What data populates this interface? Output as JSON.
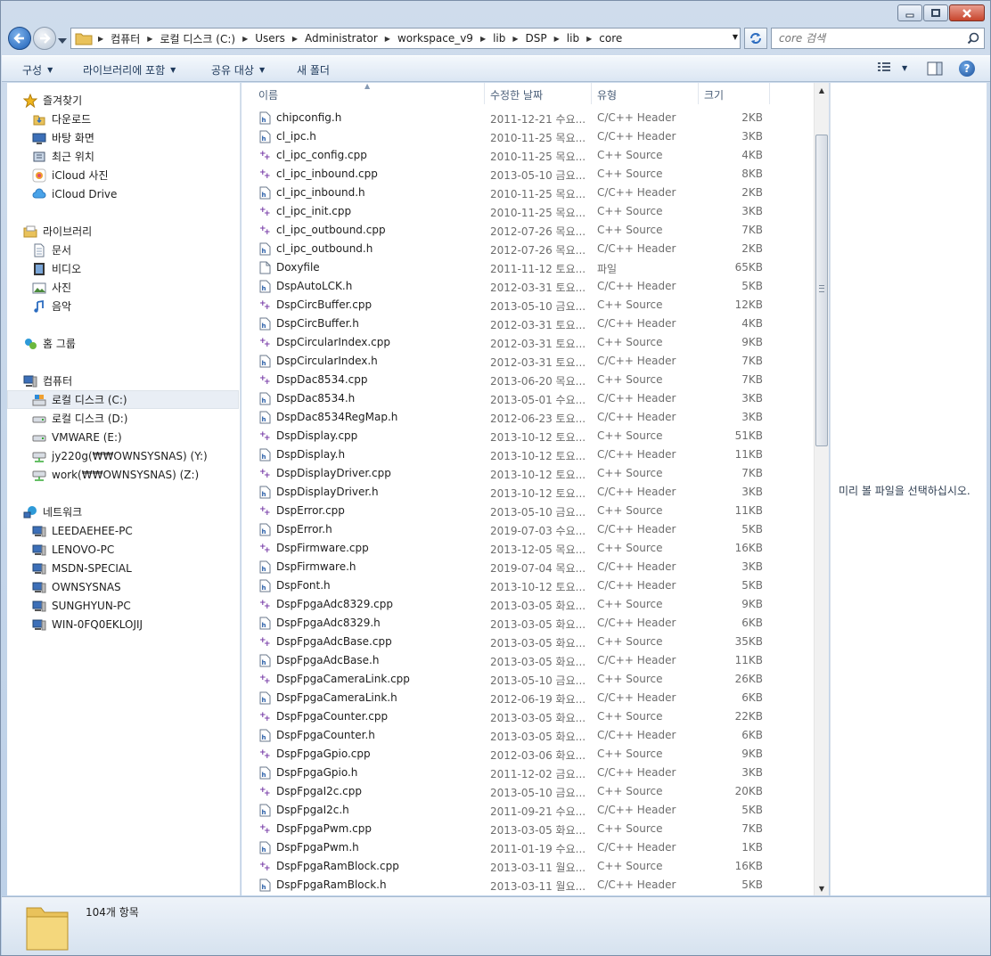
{
  "window": {
    "caption_buttons": [
      "minimize-icon",
      "maximize-icon",
      "close-icon"
    ]
  },
  "address": {
    "crumbs": [
      "컴퓨터",
      "로컬 디스크 (C:)",
      "Users",
      "Administrator",
      "workspace_v9",
      "lib",
      "DSP",
      "lib",
      "core"
    ]
  },
  "search": {
    "placeholder": "core 검색"
  },
  "toolbar": {
    "organize": "구성",
    "include_library": "라이브러리에 포함",
    "share": "공유 대상",
    "new_folder": "새 폴더"
  },
  "nav": {
    "favorites": {
      "header": "즐겨찾기",
      "items": [
        "다운로드",
        "바탕 화면",
        "최근 위치",
        "iCloud 사진",
        "iCloud Drive"
      ]
    },
    "libraries": {
      "header": "라이브러리",
      "items": [
        "문서",
        "비디오",
        "사진",
        "음악"
      ]
    },
    "homegroup": "홈 그룹",
    "computer": {
      "header": "컴퓨터",
      "items": [
        "로컬 디스크 (C:)",
        "로컬 디스크 (D:)",
        "VMWARE (E:)",
        "jy220g(₩₩OWNSYSNAS) (Y:)",
        "work(₩₩OWNSYSNAS) (Z:)"
      ]
    },
    "network": {
      "header": "네트워크",
      "items": [
        "LEEDAEHEE-PC",
        "LENOVO-PC",
        "MSDN-SPECIAL",
        "OWNSYSNAS",
        "SUNGHYUN-PC",
        "WIN-0FQ0EKLOJIJ"
      ]
    }
  },
  "columns": {
    "name": "이름",
    "date": "수정한 날짜",
    "type": "유형",
    "size": "크기"
  },
  "files": [
    {
      "name": "chipconfig.h",
      "date": "2011-12-21 수요...",
      "type": "C/C++ Header",
      "size": "2KB",
      "kind": "h"
    },
    {
      "name": "cl_ipc.h",
      "date": "2010-11-25 목요...",
      "type": "C/C++ Header",
      "size": "3KB",
      "kind": "h"
    },
    {
      "name": "cl_ipc_config.cpp",
      "date": "2010-11-25 목요...",
      "type": "C++ Source",
      "size": "4KB",
      "kind": "cpp"
    },
    {
      "name": "cl_ipc_inbound.cpp",
      "date": "2013-05-10 금요...",
      "type": "C++ Source",
      "size": "8KB",
      "kind": "cpp"
    },
    {
      "name": "cl_ipc_inbound.h",
      "date": "2010-11-25 목요...",
      "type": "C/C++ Header",
      "size": "2KB",
      "kind": "h"
    },
    {
      "name": "cl_ipc_init.cpp",
      "date": "2010-11-25 목요...",
      "type": "C++ Source",
      "size": "3KB",
      "kind": "cpp"
    },
    {
      "name": "cl_ipc_outbound.cpp",
      "date": "2012-07-26 목요...",
      "type": "C++ Source",
      "size": "7KB",
      "kind": "cpp"
    },
    {
      "name": "cl_ipc_outbound.h",
      "date": "2012-07-26 목요...",
      "type": "C/C++ Header",
      "size": "2KB",
      "kind": "h"
    },
    {
      "name": "Doxyfile",
      "date": "2011-11-12 토요...",
      "type": "파일",
      "size": "65KB",
      "kind": "file"
    },
    {
      "name": "DspAutoLCK.h",
      "date": "2012-03-31 토요...",
      "type": "C/C++ Header",
      "size": "5KB",
      "kind": "h"
    },
    {
      "name": "DspCircBuffer.cpp",
      "date": "2013-05-10 금요...",
      "type": "C++ Source",
      "size": "12KB",
      "kind": "cpp"
    },
    {
      "name": "DspCircBuffer.h",
      "date": "2012-03-31 토요...",
      "type": "C/C++ Header",
      "size": "4KB",
      "kind": "h"
    },
    {
      "name": "DspCircularIndex.cpp",
      "date": "2012-03-31 토요...",
      "type": "C++ Source",
      "size": "9KB",
      "kind": "cpp"
    },
    {
      "name": "DspCircularIndex.h",
      "date": "2012-03-31 토요...",
      "type": "C/C++ Header",
      "size": "7KB",
      "kind": "h"
    },
    {
      "name": "DspDac8534.cpp",
      "date": "2013-06-20 목요...",
      "type": "C++ Source",
      "size": "7KB",
      "kind": "cpp"
    },
    {
      "name": "DspDac8534.h",
      "date": "2013-05-01 수요...",
      "type": "C/C++ Header",
      "size": "3KB",
      "kind": "h"
    },
    {
      "name": "DspDac8534RegMap.h",
      "date": "2012-06-23 토요...",
      "type": "C/C++ Header",
      "size": "3KB",
      "kind": "h"
    },
    {
      "name": "DspDisplay.cpp",
      "date": "2013-10-12 토요...",
      "type": "C++ Source",
      "size": "51KB",
      "kind": "cpp"
    },
    {
      "name": "DspDisplay.h",
      "date": "2013-10-12 토요...",
      "type": "C/C++ Header",
      "size": "11KB",
      "kind": "h"
    },
    {
      "name": "DspDisplayDriver.cpp",
      "date": "2013-10-12 토요...",
      "type": "C++ Source",
      "size": "7KB",
      "kind": "cpp"
    },
    {
      "name": "DspDisplayDriver.h",
      "date": "2013-10-12 토요...",
      "type": "C/C++ Header",
      "size": "3KB",
      "kind": "h"
    },
    {
      "name": "DspError.cpp",
      "date": "2013-05-10 금요...",
      "type": "C++ Source",
      "size": "11KB",
      "kind": "cpp"
    },
    {
      "name": "DspError.h",
      "date": "2019-07-03 수요...",
      "type": "C/C++ Header",
      "size": "5KB",
      "kind": "h"
    },
    {
      "name": "DspFirmware.cpp",
      "date": "2013-12-05 목요...",
      "type": "C++ Source",
      "size": "16KB",
      "kind": "cpp"
    },
    {
      "name": "DspFirmware.h",
      "date": "2019-07-04 목요...",
      "type": "C/C++ Header",
      "size": "3KB",
      "kind": "h"
    },
    {
      "name": "DspFont.h",
      "date": "2013-10-12 토요...",
      "type": "C/C++ Header",
      "size": "5KB",
      "kind": "h"
    },
    {
      "name": "DspFpgaAdc8329.cpp",
      "date": "2013-03-05 화요...",
      "type": "C++ Source",
      "size": "9KB",
      "kind": "cpp"
    },
    {
      "name": "DspFpgaAdc8329.h",
      "date": "2013-03-05 화요...",
      "type": "C/C++ Header",
      "size": "6KB",
      "kind": "h"
    },
    {
      "name": "DspFpgaAdcBase.cpp",
      "date": "2013-03-05 화요...",
      "type": "C++ Source",
      "size": "35KB",
      "kind": "cpp"
    },
    {
      "name": "DspFpgaAdcBase.h",
      "date": "2013-03-05 화요...",
      "type": "C/C++ Header",
      "size": "11KB",
      "kind": "h"
    },
    {
      "name": "DspFpgaCameraLink.cpp",
      "date": "2013-05-10 금요...",
      "type": "C++ Source",
      "size": "26KB",
      "kind": "cpp"
    },
    {
      "name": "DspFpgaCameraLink.h",
      "date": "2012-06-19 화요...",
      "type": "C/C++ Header",
      "size": "6KB",
      "kind": "h"
    },
    {
      "name": "DspFpgaCounter.cpp",
      "date": "2013-03-05 화요...",
      "type": "C++ Source",
      "size": "22KB",
      "kind": "cpp"
    },
    {
      "name": "DspFpgaCounter.h",
      "date": "2013-03-05 화요...",
      "type": "C/C++ Header",
      "size": "6KB",
      "kind": "h"
    },
    {
      "name": "DspFpgaGpio.cpp",
      "date": "2012-03-06 화요...",
      "type": "C++ Source",
      "size": "9KB",
      "kind": "cpp"
    },
    {
      "name": "DspFpgaGpio.h",
      "date": "2011-12-02 금요...",
      "type": "C/C++ Header",
      "size": "3KB",
      "kind": "h"
    },
    {
      "name": "DspFpgaI2c.cpp",
      "date": "2013-05-10 금요...",
      "type": "C++ Source",
      "size": "20KB",
      "kind": "cpp"
    },
    {
      "name": "DspFpgaI2c.h",
      "date": "2011-09-21 수요...",
      "type": "C/C++ Header",
      "size": "5KB",
      "kind": "h"
    },
    {
      "name": "DspFpgaPwm.cpp",
      "date": "2013-03-05 화요...",
      "type": "C++ Source",
      "size": "7KB",
      "kind": "cpp"
    },
    {
      "name": "DspFpgaPwm.h",
      "date": "2011-01-19 수요...",
      "type": "C/C++ Header",
      "size": "1KB",
      "kind": "h"
    },
    {
      "name": "DspFpgaRamBlock.cpp",
      "date": "2013-03-11 월요...",
      "type": "C++ Source",
      "size": "16KB",
      "kind": "cpp"
    },
    {
      "name": "DspFpgaRamBlock.h",
      "date": "2013-03-11 월요...",
      "type": "C/C++ Header",
      "size": "5KB",
      "kind": "h"
    }
  ],
  "preview": {
    "message": "미리 볼 파일을 선택하십시오."
  },
  "status": {
    "count": "104개 항목"
  },
  "colors": {
    "header_text": "#4c607a",
    "cpp_icon": "#7a3fa8",
    "h_icon": "#2b5fa8"
  }
}
